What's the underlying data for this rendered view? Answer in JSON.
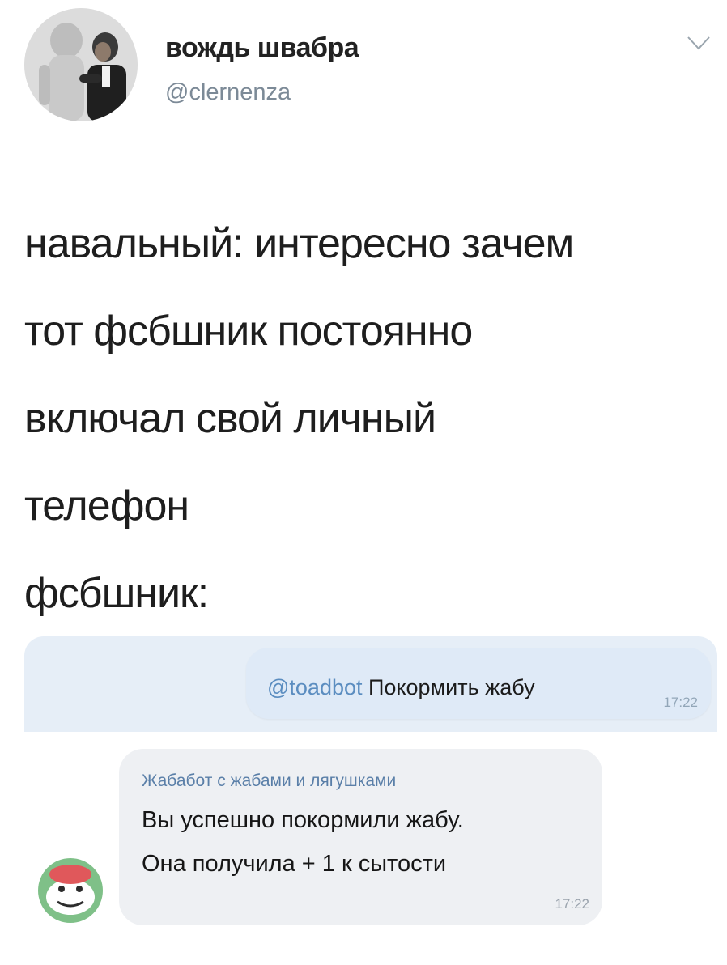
{
  "tweet": {
    "display_name": "вождь швабра",
    "handle": "@clernenza",
    "lines": [
      "навальный: интересно зачем",
      "тот фсбшник постоянно",
      "включал свой личный",
      "телефон",
      "фсбшник:"
    ]
  },
  "chat": {
    "outgoing": {
      "mention": "@toadbot",
      "text": " Покормить жабу",
      "time": "17:22"
    },
    "incoming": {
      "sender": "Жабабот с жабами и лягушками",
      "line1": "Вы успешно покормили жабу.",
      "line2": "Она получила + 1 к сытости",
      "time": "17:22"
    }
  },
  "colors": {
    "chat_background": "#e6eef7",
    "outgoing_bubble": "#dfeaf7",
    "incoming_bubble": "#eef0f3",
    "mention": "#5b8dc0",
    "sender_name": "#5a7fa8"
  },
  "icons": {
    "dropdown": "chevron-down-icon",
    "bot_avatar": "frog-icon"
  }
}
